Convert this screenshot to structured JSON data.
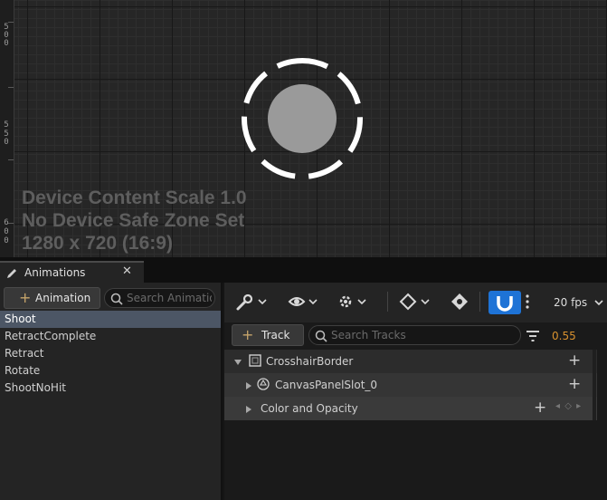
{
  "viewport": {
    "ruler_labels": [
      {
        "digits": [
          "5",
          "0",
          "0"
        ]
      },
      {
        "digits": [
          "5",
          "5",
          "0"
        ]
      },
      {
        "digits": [
          "6",
          "0",
          "0"
        ]
      }
    ],
    "device_info": [
      "Device Content Scale 1.0",
      "No Device Safe Zone Set",
      "1280 x 720 (16:9)"
    ]
  },
  "tab": {
    "label": "Animations",
    "close": "✕"
  },
  "animations_panel": {
    "add_label": "Animation",
    "search_placeholder": "Search Animations",
    "items": [
      {
        "label": "Shoot",
        "selected": true
      },
      {
        "label": "RetractComplete",
        "selected": false
      },
      {
        "label": "Retract",
        "selected": false
      },
      {
        "label": "Rotate",
        "selected": false
      },
      {
        "label": "ShootNoHit",
        "selected": false
      }
    ]
  },
  "toolbar": {
    "fps": "20 fps"
  },
  "tracks_bar": {
    "add_label": "Track",
    "search_placeholder": "Search Tracks",
    "current_time": "0.55"
  },
  "tracks": {
    "rows": [
      {
        "label": "CrosshairBorder"
      },
      {
        "label": "CanvasPanelSlot_0"
      },
      {
        "label": "Color and Opacity"
      }
    ],
    "add_symbol": "+",
    "key_nav": "◂ ◇ ▸"
  },
  "colors": {
    "accent_blue": "#1e73d6",
    "time_orange": "#d9922e",
    "add_plus": "#c6a46a",
    "selection": "#4c5665"
  }
}
